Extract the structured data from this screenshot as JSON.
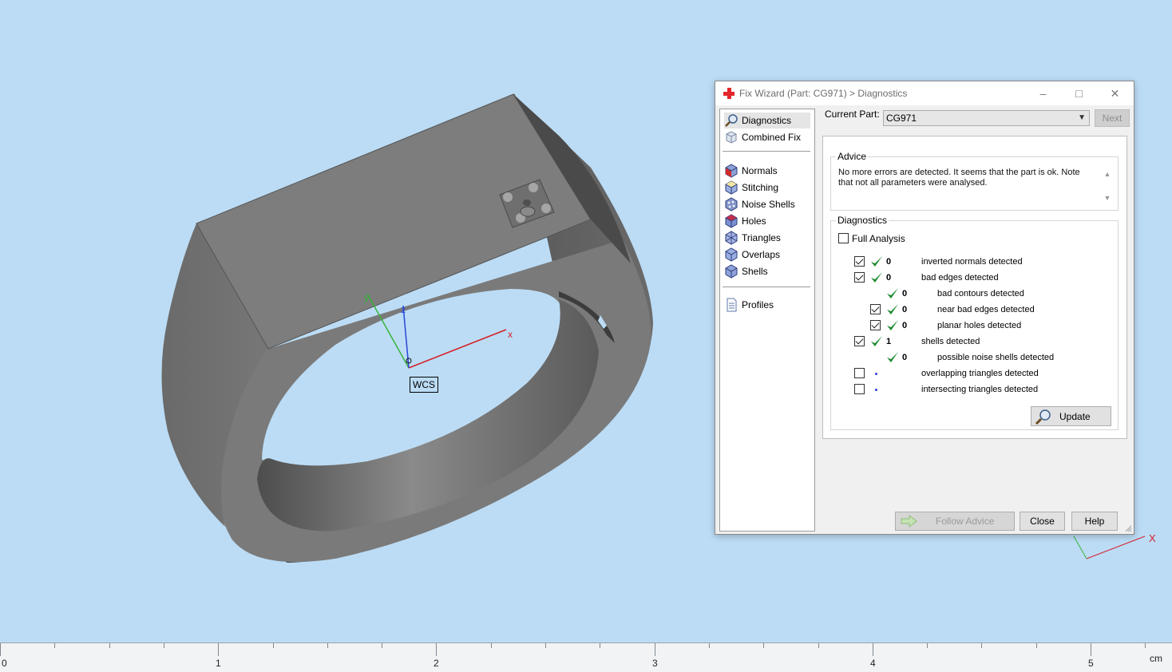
{
  "viewport": {
    "wcs_label": "WCS",
    "axis_x": "x",
    "axis_y": "y",
    "axis_z": "z",
    "mini_axis_x": "X"
  },
  "ruler": {
    "labels": [
      "0",
      "1",
      "2",
      "3",
      "4",
      "5"
    ],
    "unit": "cm"
  },
  "dialog": {
    "title": "Fix Wizard (Part: CG971) > Diagnostics",
    "minimize": "–",
    "maximize": "□",
    "close": "✕",
    "nav": {
      "diagnostics": "Diagnostics",
      "combined_fix": "Combined Fix",
      "normals": "Normals",
      "stitching": "Stitching",
      "noise_shells": "Noise Shells",
      "holes": "Holes",
      "triangles": "Triangles",
      "overlaps": "Overlaps",
      "shells": "Shells",
      "profiles": "Profiles"
    },
    "current_part_label": "Current Part:",
    "current_part_value": "CG971",
    "next_label": "Next",
    "advice_title": "Advice",
    "advice_text": "No more errors are detected. It seems that the part is ok. Note that not all parameters were analysed.",
    "diagnostics_title": "Diagnostics",
    "full_analysis_label": "Full Analysis",
    "rows": [
      {
        "count": "0",
        "label": "inverted normals detected"
      },
      {
        "count": "0",
        "label": "bad edges detected"
      },
      {
        "count": "0",
        "label": "bad contours detected"
      },
      {
        "count": "0",
        "label": "near bad edges detected"
      },
      {
        "count": "0",
        "label": "planar holes detected"
      },
      {
        "count": "1",
        "label": "shells detected"
      },
      {
        "count": "0",
        "label": "possible noise shells detected"
      },
      {
        "count": "",
        "label": "overlapping triangles detected"
      },
      {
        "count": "",
        "label": "intersecting triangles detected"
      }
    ],
    "update_label": "Update",
    "follow_advice_label": "Follow Advice",
    "close_label": "Close",
    "help_label": "Help"
  },
  "colors": {
    "background": "#bcdcf5",
    "model_gray": "#7a7a7a",
    "check_green": "#1f8a2e",
    "accent_red": "#e2262b"
  }
}
